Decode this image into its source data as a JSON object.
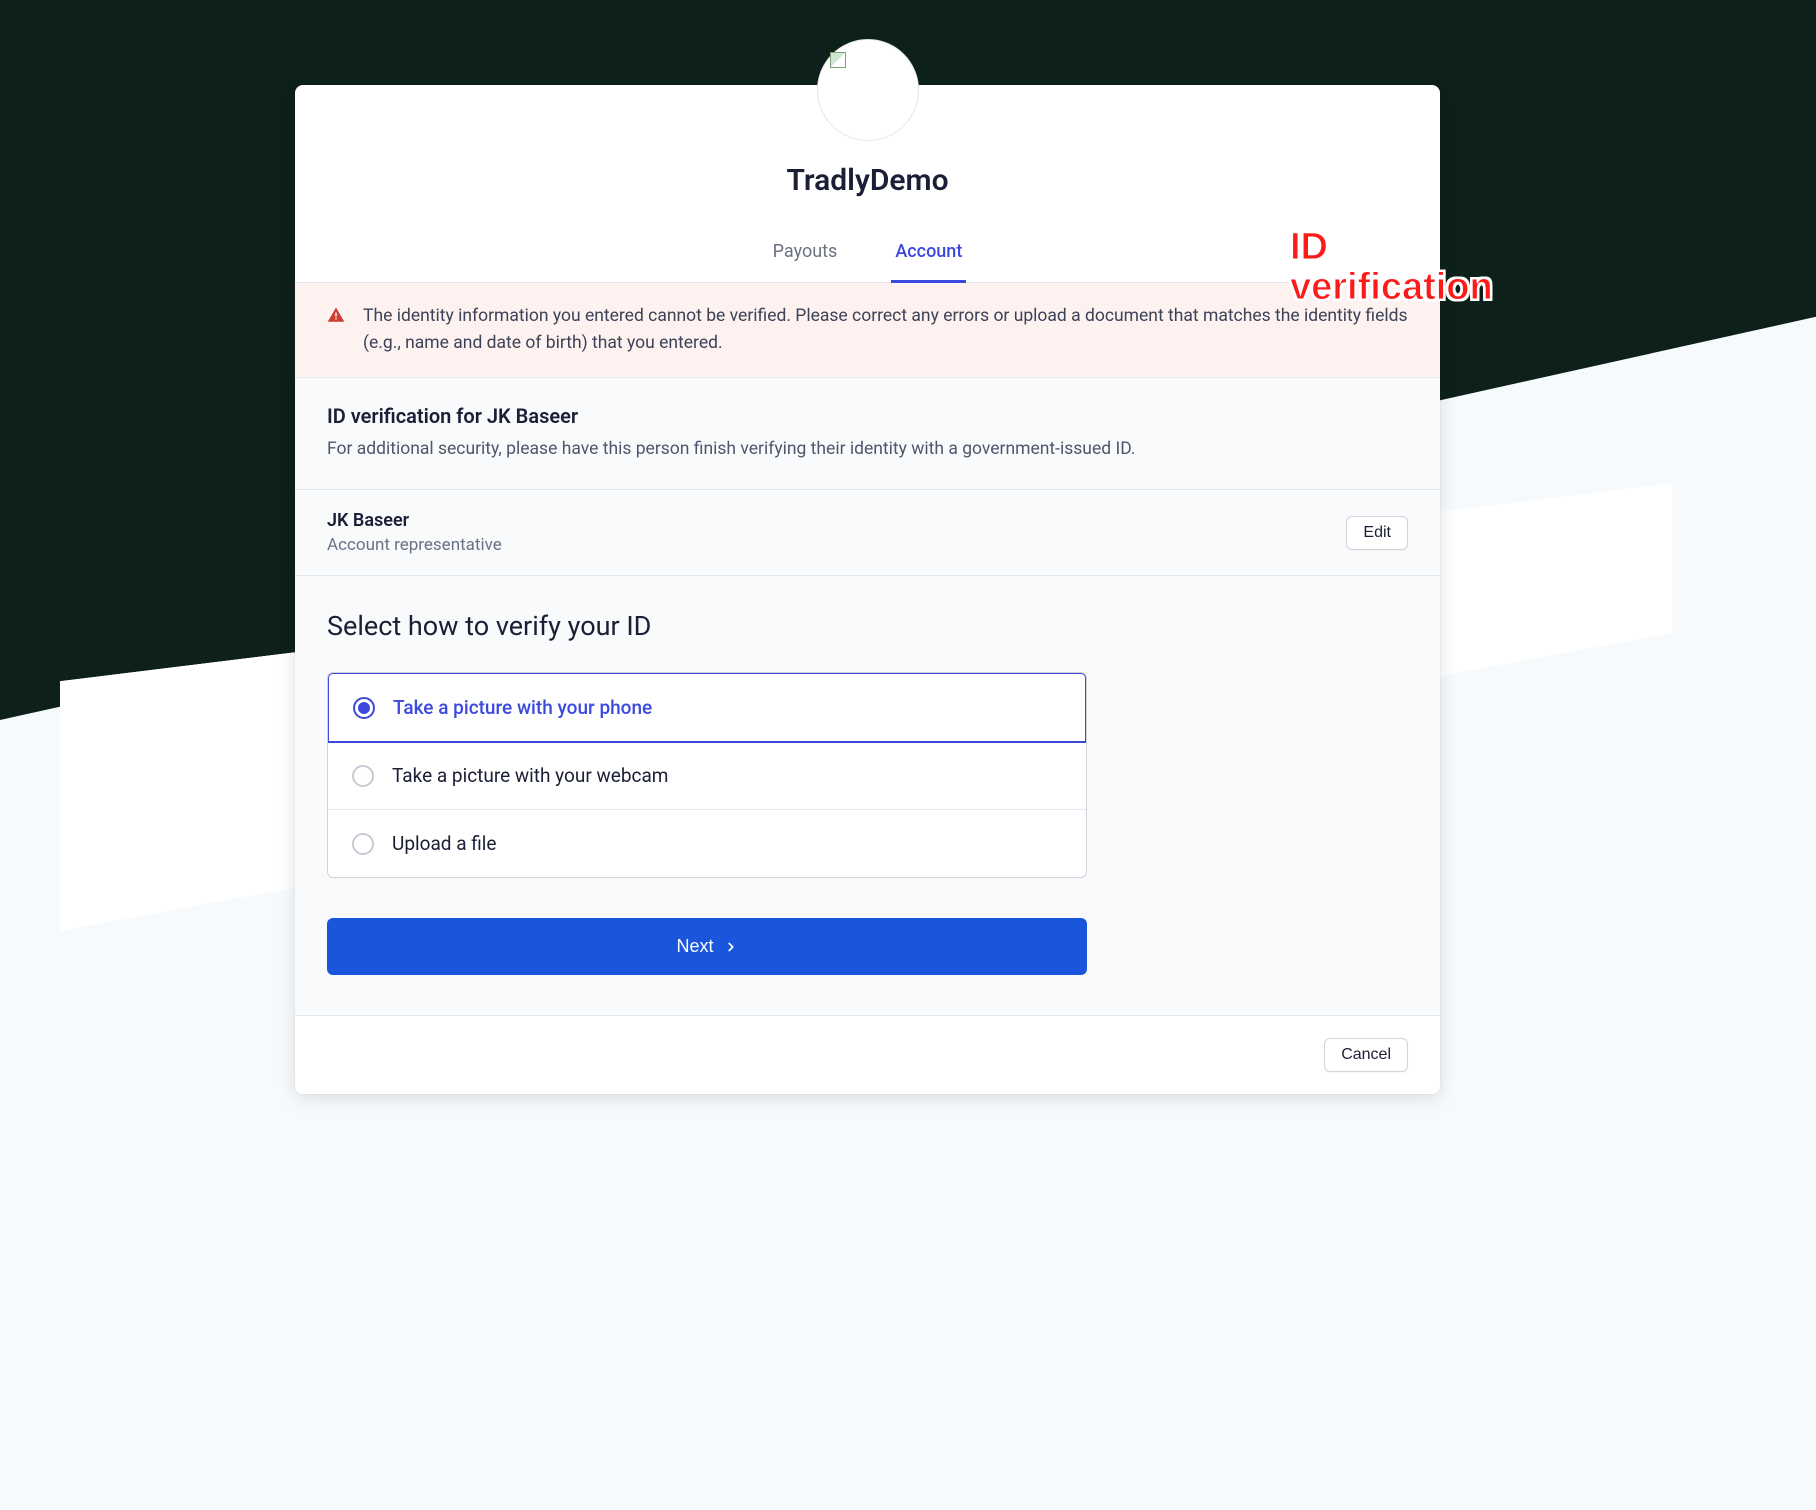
{
  "brand": "TradlyDemo",
  "tabs": {
    "payouts": "Payouts",
    "account": "Account"
  },
  "alert": {
    "message": "The identity information you entered cannot be verified. Please correct any errors or upload a document that matches the identity fields (e.g., name and date of birth) that you entered."
  },
  "verification": {
    "heading": "ID verification for JK Baseer",
    "description": "For additional security, please have this person finish verifying their identity with a government-issued ID."
  },
  "person": {
    "name": "JK Baseer",
    "role": "Account representative",
    "edit_label": "Edit"
  },
  "verify": {
    "title": "Select how to verify your ID",
    "options": {
      "phone": "Take a picture with your phone",
      "webcam": "Take a picture with your webcam",
      "upload": "Upload a file"
    },
    "next_label": "Next"
  },
  "footer": {
    "cancel_label": "Cancel"
  },
  "annotation": {
    "line1": "ID",
    "line2": "verification"
  }
}
